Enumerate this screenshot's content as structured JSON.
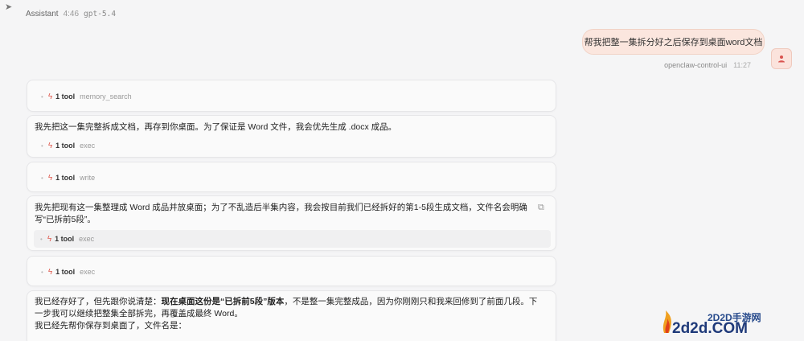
{
  "header": {
    "name": "Assistant",
    "time": "4:46",
    "model": "gpt-5.4"
  },
  "user": {
    "message": "帮我把整一集拆分好之后保存到桌面word文档",
    "meta_name": "openclaw-control-ui",
    "meta_time": "11:27",
    "avatar_icon": "user-icon"
  },
  "cards": [
    {
      "tool_count": "1 tool",
      "tool_name": "memory_search"
    },
    {
      "text": "我先把这一集完整拆成文档，再存到你桌面。为了保证是 Word 文件，我会优先生成 .docx 成品。",
      "tool_count": "1 tool",
      "tool_name": "exec"
    },
    {
      "tool_count": "1 tool",
      "tool_name": "write"
    },
    {
      "text": "我先把现有这一集整理成 Word 成品并放桌面；为了不乱造后半集内容，我会按目前我们已经拆好的第1-5段生成文档，文件名会明确写“已拆前5段”。",
      "tool_count": "1 tool",
      "tool_name": "exec"
    },
    {
      "tool_count": "1 tool",
      "tool_name": "exec"
    },
    {
      "text_a": "我已经存好了，但先跟你说清楚：",
      "text_bold": "现在桌面这份是“已拆前5段”版本",
      "text_b": "，不是整一集完整成品，因为你刚刚只和我来回修到了前面几段。下一步我可以继续把整集全部拆完，再覆盖成最终 Word。",
      "text_c": "我已经先帮你保存到桌面了，文件名是："
    }
  ],
  "watermark": {
    "cn": "2D2D手游网",
    "en": "2d2d.COM"
  }
}
